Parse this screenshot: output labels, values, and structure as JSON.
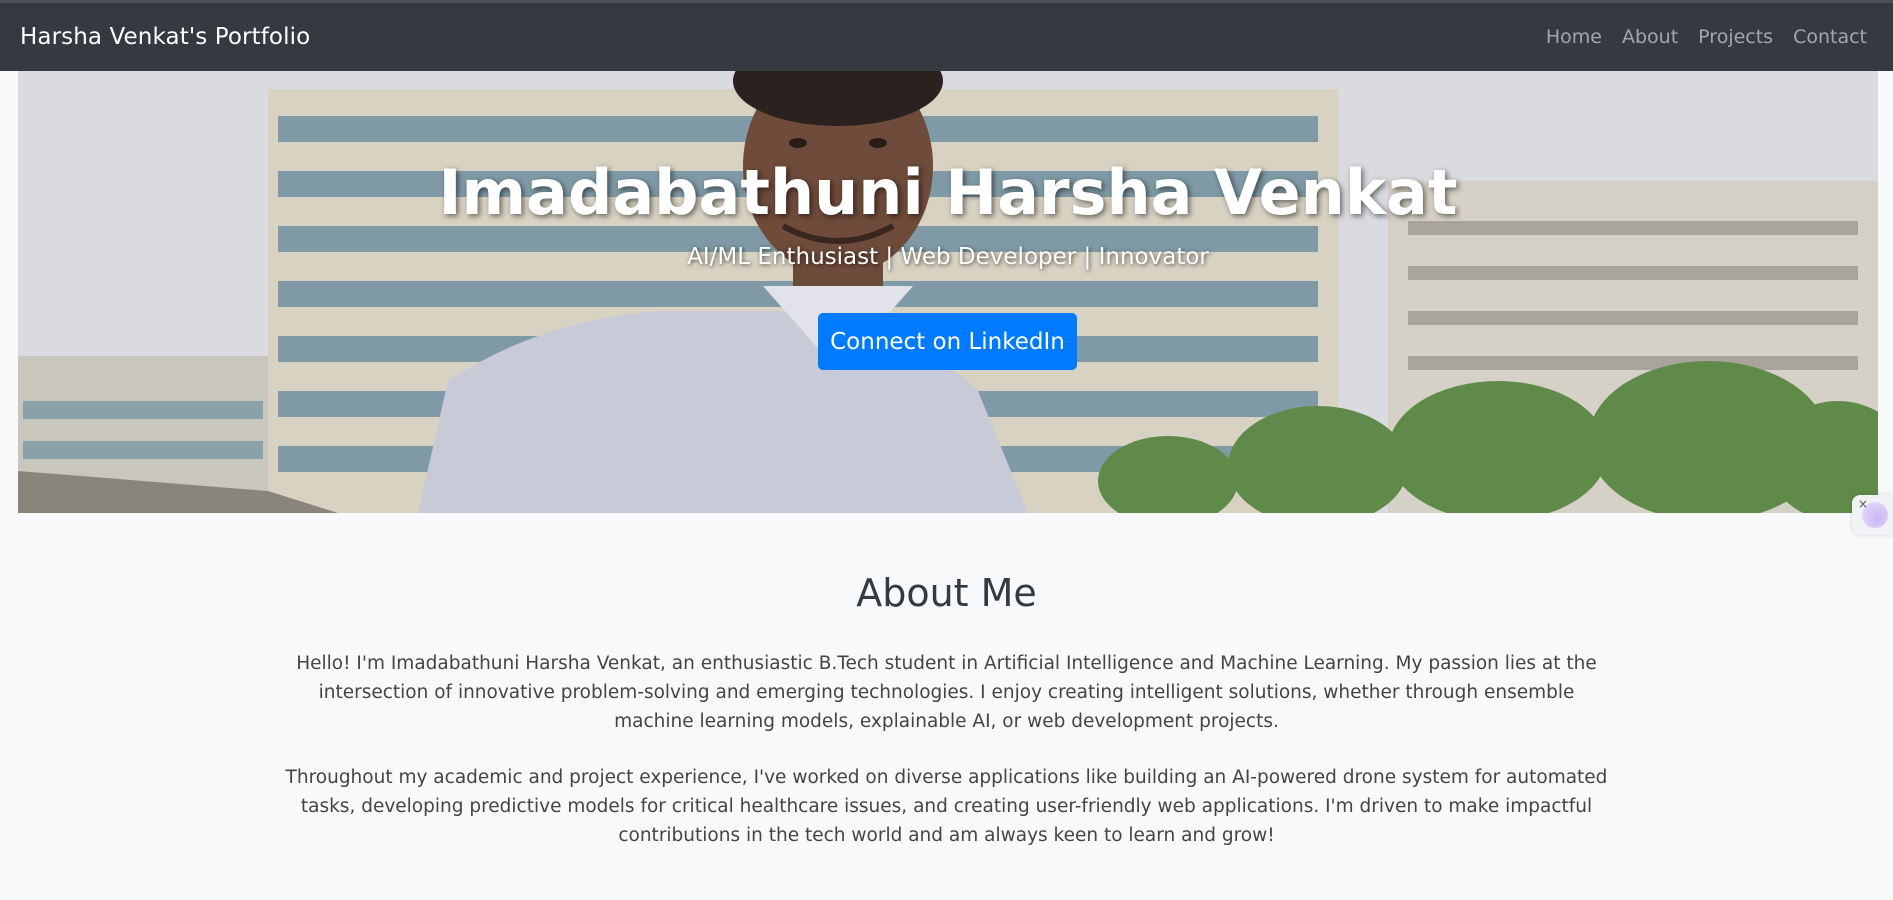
{
  "navbar": {
    "brand": "Harsha Venkat's Portfolio",
    "links": [
      "Home",
      "About",
      "Projects",
      "Contact"
    ]
  },
  "hero": {
    "title": "Imadabathuni Harsha Venkat",
    "subtitle": "AI/ML Enthusiast | Web Developer | Innovator",
    "cta_label": "Connect on LinkedIn"
  },
  "about": {
    "title": "About Me",
    "paragraph1": "Hello! I'm Imadabathuni Harsha Venkat, an enthusiastic B.Tech student in Artificial Intelligence and Machine Learning. My passion lies at the intersection of innovative problem-solving and emerging technologies. I enjoy creating intelligent solutions, whether through ensemble machine learning models, explainable AI, or web development projects.",
    "paragraph2": "Throughout my academic and project experience, I've worked on diverse applications like building an AI-powered drone system for automated tasks, developing predictive models for critical healthcare issues, and creating user-friendly web applications. I'm driven to make impactful contributions in the tech world and am always keen to learn and grow!"
  },
  "colors": {
    "navbar_bg": "#343a40",
    "primary": "#007bff",
    "page_bg": "#f8f9fa"
  },
  "icons": [
    "avatar-photo",
    "side-widget-icon"
  ]
}
